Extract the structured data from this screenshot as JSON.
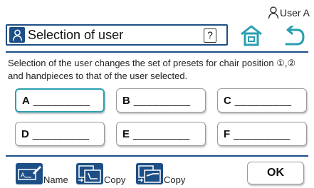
{
  "current_user": {
    "label": "User A",
    "icon": "person-outline-icon"
  },
  "header": {
    "title": "Selection of user",
    "help_label": "?",
    "home_icon": "home-icon",
    "back_icon": "back-arrow-icon",
    "accent_color": "#1d4f86"
  },
  "description": "Selection of the user changes the set of presets for chair position ①,② and handpieces to that of the user selected.",
  "users": [
    {
      "letter": "A",
      "blank": "_________",
      "selected": true
    },
    {
      "letter": "B",
      "blank": "_________",
      "selected": false
    },
    {
      "letter": "C",
      "blank": "_________",
      "selected": false
    },
    {
      "letter": "D",
      "blank": "_________",
      "selected": false
    },
    {
      "letter": "E",
      "blank": "_________",
      "selected": false
    },
    {
      "letter": "F",
      "blank": "_________",
      "selected": false
    }
  ],
  "selected_border_color": "#2a9fb0",
  "tools": [
    {
      "label": "Name",
      "icon": "edit-name-icon"
    },
    {
      "label": "Copy",
      "icon": "copy-chair-icon"
    },
    {
      "label": "Copy",
      "icon": "copy-handpiece-icon"
    }
  ],
  "ok_label": "OK"
}
